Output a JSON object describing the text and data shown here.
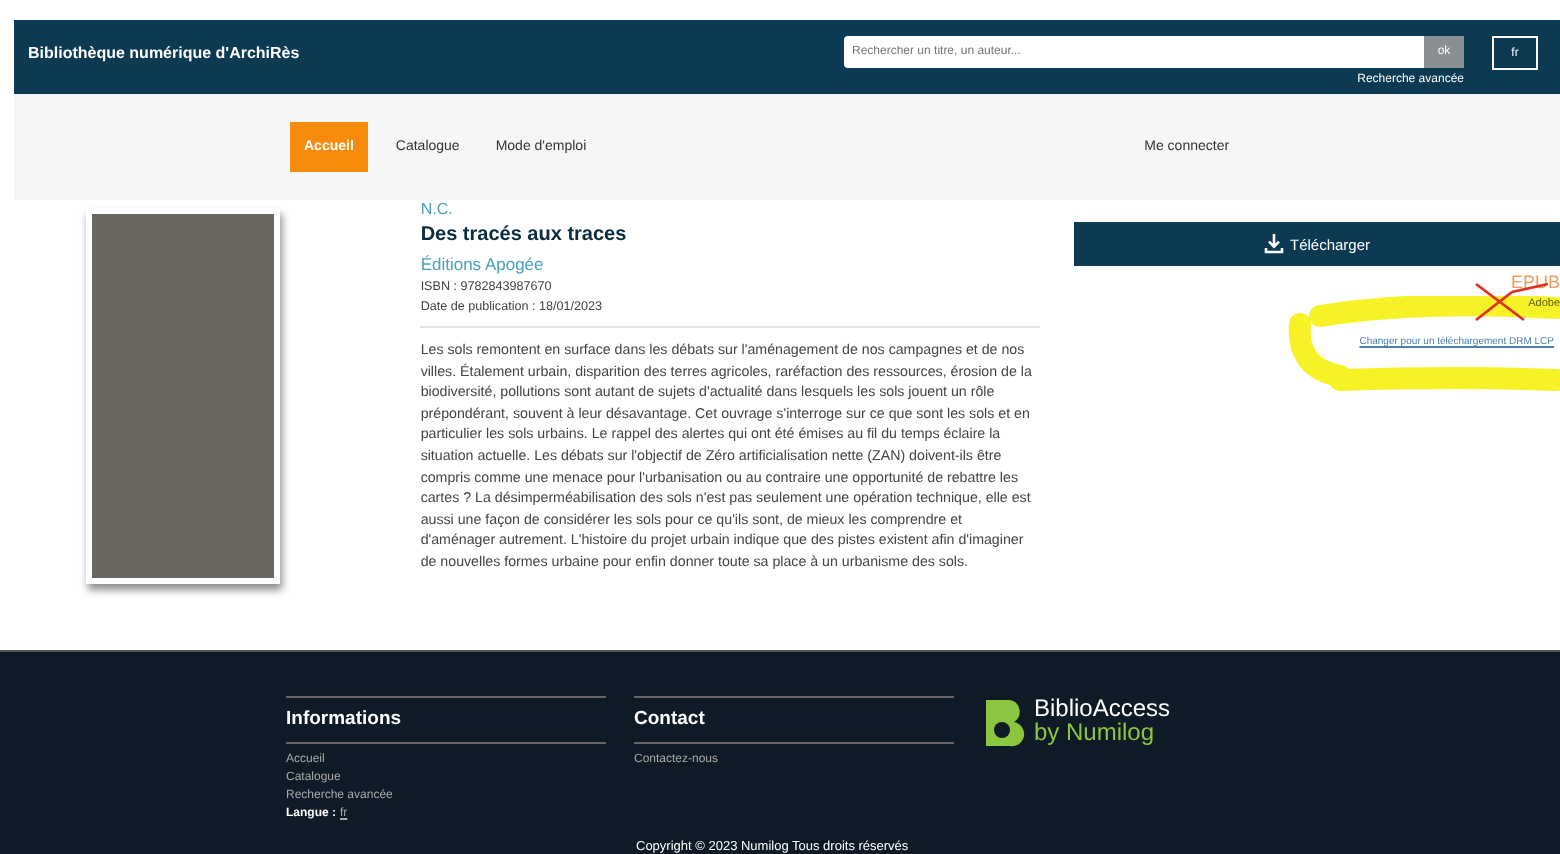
{
  "header": {
    "site_title": "Bibliothèque numérique d'ArchiRès",
    "search": {
      "placeholder": "Rechercher un titre, un auteur..."
    },
    "search_button": "ok",
    "advanced_search": "Recherche avancée",
    "language_button": "fr"
  },
  "nav": {
    "items": [
      {
        "label": "Accueil",
        "selected": true
      },
      {
        "label": "Catalogue",
        "selected": false
      },
      {
        "label": "Mode d'emploi",
        "selected": false
      }
    ],
    "login": "Me connecter"
  },
  "book": {
    "author": "N.C.",
    "title": "Des tracés aux traces",
    "publisher": "Éditions Apogée",
    "isbn": "ISBN : 9782843987670",
    "date": "Date de publication : 18/01/2023",
    "description": "Les sols remontent en surface dans les débats sur l'aménagement de nos campagnes et de nos villes. Étalement urbain, disparition des terres agricoles, raréfaction des ressources, érosion de la biodiversité, pollutions sont autant de sujets d'actualité dans lesquels les sols jouent un rôle prépondérant, souvent à leur désavantage. Cet ouvrage s'interroge sur ce que sont les sols et en particulier les sols urbains. Le rappel des alertes qui ont été émises au fil du temps éclaire la situation actuelle. Les débats sur l'objectif de Zéro artificialisation nette (ZAN) doivent-ils être compris comme une menace pour l'urbanisation ou au contraire une opportunité de rebattre les cartes ? La désimperméabilisation des sols n'est pas seulement une opération technique, elle est aussi une façon de considérer les sols pour ce qu'ils sont, de mieux les comprendre et d'aménager autrement. L'histoire du projet urbain indique que des pistes existent afin d'imaginer de nouvelles formes urbaine pour enfin donner toute sa place à un urbanisme des sols."
  },
  "download": {
    "button": "Télécharger",
    "format": "EPUB",
    "drm": "Adobe",
    "change_link": "Changer pour un téléchargement DRM LCP"
  },
  "footer": {
    "columns": [
      {
        "title": "Informations",
        "links": [
          "Accueil",
          "Catalogue",
          "Recherche avancée"
        ],
        "language_label": "Langue :",
        "language_value": "fr"
      },
      {
        "title": "Contact",
        "links": [
          "Contactez-nous"
        ]
      }
    ],
    "logo_name": "BiblioAccess",
    "logo_sub": "by Numilog",
    "copyright": "Copyright © 2023 Numilog Tous droits réservés"
  }
}
